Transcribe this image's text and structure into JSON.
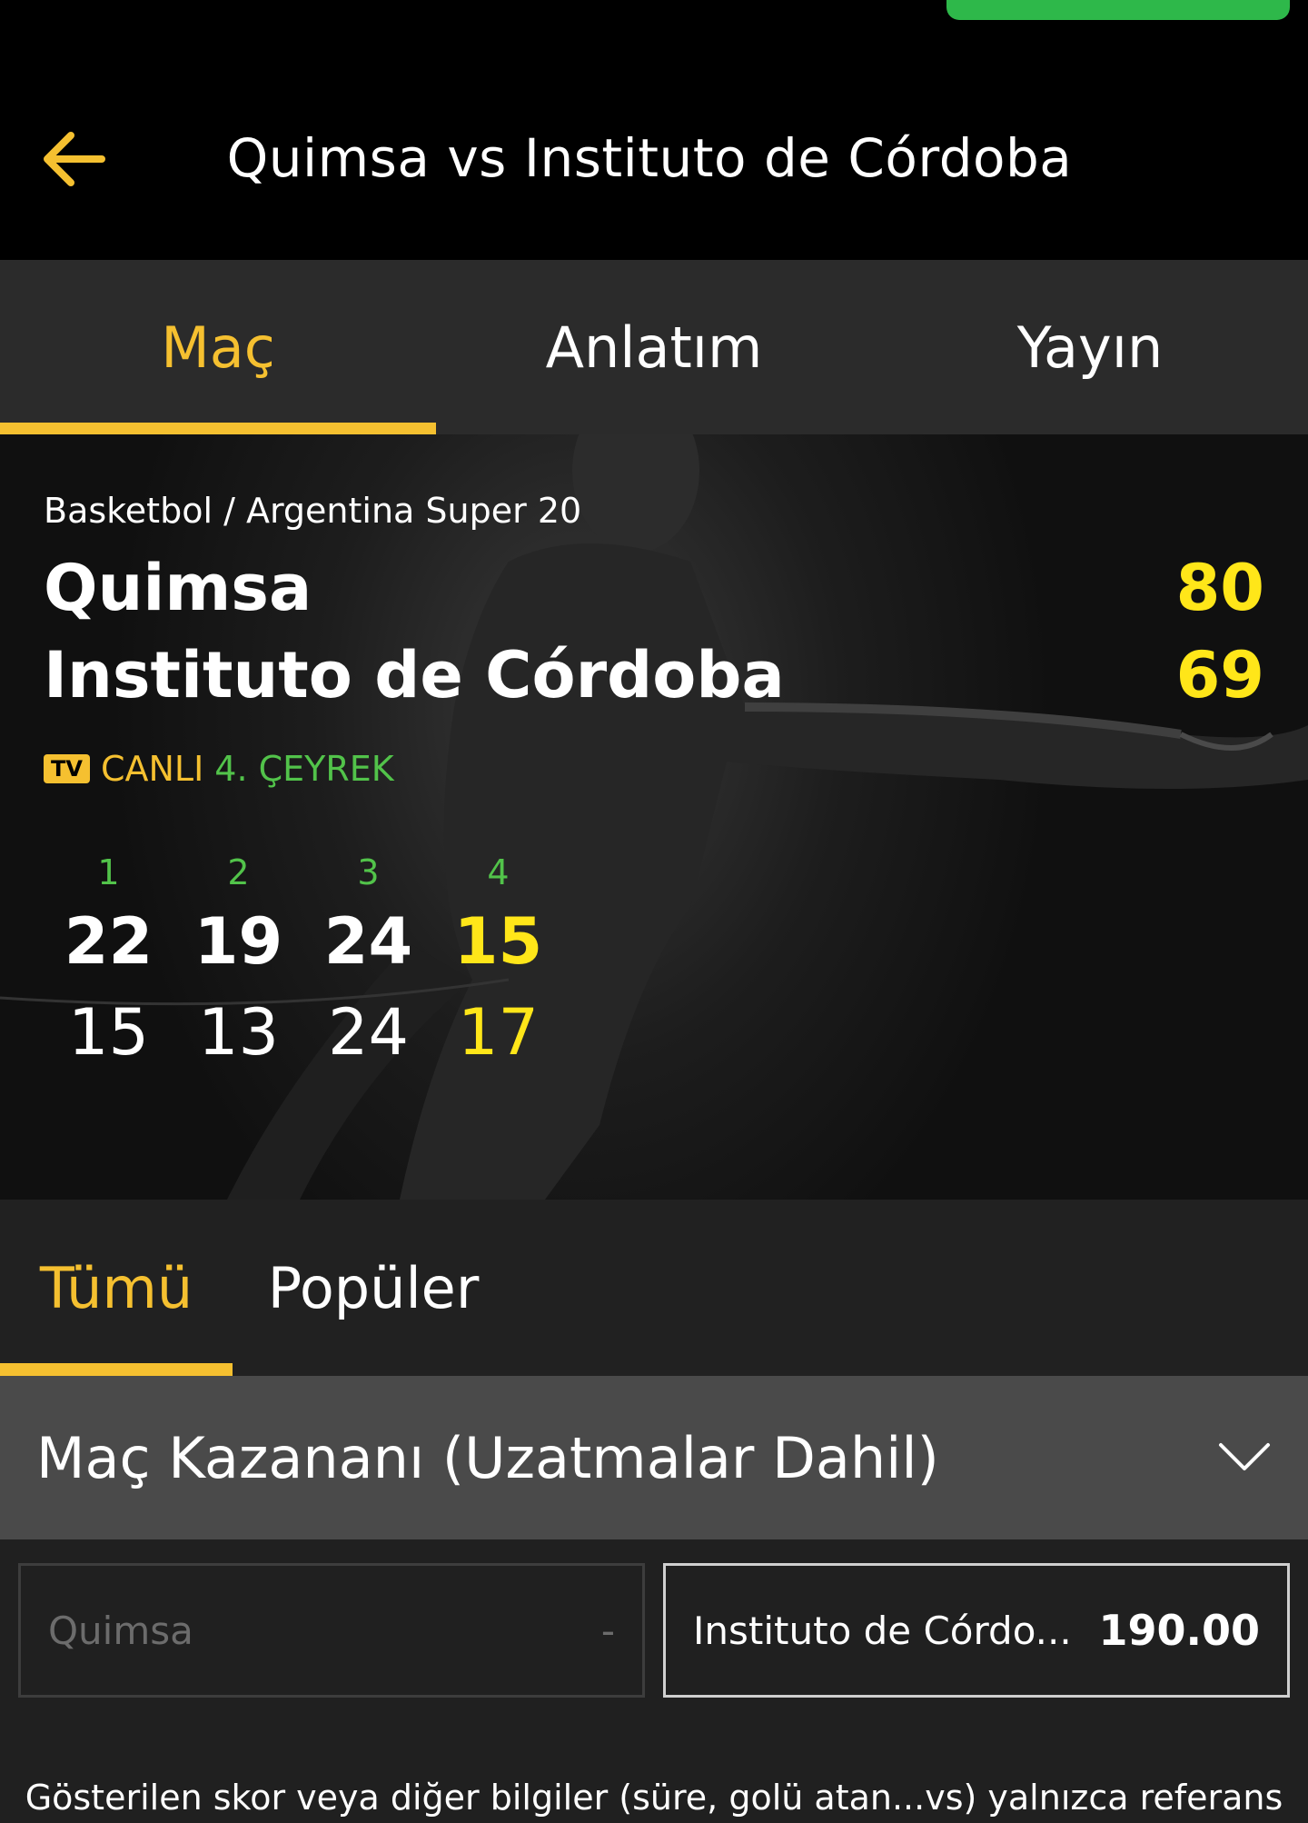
{
  "header": {
    "title": "Quimsa vs Instituto de Córdoba",
    "back_icon": "arrow-left-icon",
    "accent": "#f5c030"
  },
  "main_tabs": [
    {
      "label": "Maç",
      "active": true
    },
    {
      "label": "Anlatım",
      "active": false
    },
    {
      "label": "Yayın",
      "active": false
    }
  ],
  "scoreboard": {
    "breadcrumb": "Basketbol / Argentina Super 20",
    "home": {
      "name": "Quimsa",
      "score": "80"
    },
    "away": {
      "name": "Instituto de Córdoba",
      "score": "69"
    },
    "tv_badge": "TV",
    "live_label": "CANLI",
    "period": "4. ÇEYREK",
    "quarters": [
      {
        "label": "1",
        "home": "22",
        "away": "15"
      },
      {
        "label": "2",
        "home": "19",
        "away": "13"
      },
      {
        "label": "3",
        "home": "24",
        "away": "24"
      },
      {
        "label": "4",
        "home": "15",
        "away": "17"
      }
    ],
    "score_color": "#ffe619",
    "live_color": "#52c34a"
  },
  "market_tabs": [
    {
      "label": "Tümü",
      "active": true
    },
    {
      "label": "Popüler",
      "active": false
    }
  ],
  "market": {
    "title": "Maç Kazananı (Uzatmalar Dahil)",
    "toggle_icon": "chevron-down-icon",
    "outcomes": [
      {
        "name": "Quimsa",
        "value": "-",
        "enabled": false
      },
      {
        "name": "Instituto de Córdo...",
        "value": "190.00",
        "enabled": true
      }
    ]
  },
  "disclaimer": "Gösterilen skor veya diğer bilgiler (süre, golü atan...vs) yalnızca referans"
}
